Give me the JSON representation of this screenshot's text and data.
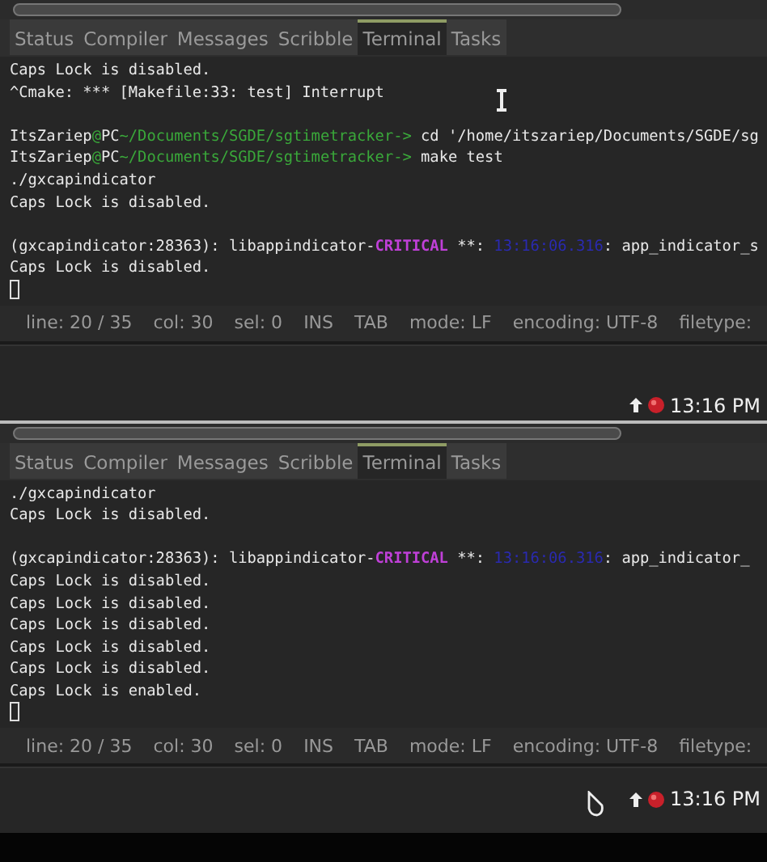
{
  "panels": [
    {
      "tabs": [
        {
          "label": "Status",
          "selected": false
        },
        {
          "label": "Compiler",
          "selected": false
        },
        {
          "label": "Messages",
          "selected": false
        },
        {
          "label": "Scribble",
          "selected": false
        },
        {
          "label": "Terminal",
          "selected": true
        },
        {
          "label": "Tasks",
          "selected": false
        }
      ],
      "lines": [
        {
          "kind": "text",
          "segments": [
            {
              "text": "Caps Lock is disabled.",
              "kind": "plain"
            }
          ]
        },
        {
          "kind": "text",
          "segments": [
            {
              "text": "^Cmake: *** [Makefile:33: test] Interrupt",
              "kind": "plain"
            }
          ]
        },
        {
          "kind": "blank"
        },
        {
          "kind": "text",
          "segments": [
            {
              "text": "ItsZariep",
              "kind": "plain"
            },
            {
              "text": "@",
              "kind": "accent"
            },
            {
              "text": "PC",
              "kind": "plain"
            },
            {
              "text": "~/Documents/SGDE/sgtimetracker->",
              "kind": "accent"
            },
            {
              "text": " cd '/home/itszariep/Documents/SGDE/sg",
              "kind": "plain"
            }
          ]
        },
        {
          "kind": "text",
          "segments": [
            {
              "text": "ItsZariep",
              "kind": "plain"
            },
            {
              "text": "@",
              "kind": "accent"
            },
            {
              "text": "PC",
              "kind": "plain"
            },
            {
              "text": "~/Documents/SGDE/sgtimetracker->",
              "kind": "accent"
            },
            {
              "text": " make test",
              "kind": "plain"
            }
          ]
        },
        {
          "kind": "text",
          "segments": [
            {
              "text": "./gxcapindicator",
              "kind": "plain"
            }
          ]
        },
        {
          "kind": "text",
          "segments": [
            {
              "text": "Caps Lock is disabled.",
              "kind": "plain"
            }
          ]
        },
        {
          "kind": "blank"
        },
        {
          "kind": "text",
          "segments": [
            {
              "text": "(gxcapindicator:28363): libappindicator-",
              "kind": "plain"
            },
            {
              "text": "CRITICAL",
              "kind": "critical"
            },
            {
              "text": " **: ",
              "kind": "plain"
            },
            {
              "text": "13:16:06.316",
              "kind": "timestamp"
            },
            {
              "text": ": app_indicator_s",
              "kind": "plain"
            }
          ]
        },
        {
          "kind": "text",
          "segments": [
            {
              "text": "Caps Lock is disabled.",
              "kind": "plain"
            }
          ]
        }
      ],
      "status_bar": [
        "line: 20 / 35",
        "col: 30",
        "sel: 0",
        "INS",
        "TAB",
        "mode: LF",
        "encoding: UTF-8",
        "filetype:"
      ],
      "pointer": {
        "kind": "ibeam"
      },
      "clock": "13:16 PM"
    },
    {
      "tabs": [
        {
          "label": "Status",
          "selected": false
        },
        {
          "label": "Compiler",
          "selected": false
        },
        {
          "label": "Messages",
          "selected": false
        },
        {
          "label": "Scribble",
          "selected": false
        },
        {
          "label": "Terminal",
          "selected": true
        },
        {
          "label": "Tasks",
          "selected": false
        }
      ],
      "lines": [
        {
          "kind": "text",
          "segments": [
            {
              "text": "./gxcapindicator",
              "kind": "plain"
            }
          ]
        },
        {
          "kind": "text",
          "segments": [
            {
              "text": "Caps Lock is disabled.",
              "kind": "plain"
            }
          ]
        },
        {
          "kind": "blank"
        },
        {
          "kind": "text",
          "segments": [
            {
              "text": "(gxcapindicator:28363): libappindicator-",
              "kind": "plain"
            },
            {
              "text": "CRITICAL",
              "kind": "critical"
            },
            {
              "text": " **: ",
              "kind": "plain"
            },
            {
              "text": "13:16:06.316",
              "kind": "timestamp"
            },
            {
              "text": ": app_indicator_",
              "kind": "plain"
            }
          ]
        },
        {
          "kind": "text",
          "segments": [
            {
              "text": "Caps Lock is disabled.",
              "kind": "plain"
            }
          ]
        },
        {
          "kind": "text",
          "segments": [
            {
              "text": "Caps Lock is disabled.",
              "kind": "plain"
            }
          ]
        },
        {
          "kind": "text",
          "segments": [
            {
              "text": "Caps Lock is disabled.",
              "kind": "plain"
            }
          ]
        },
        {
          "kind": "text",
          "segments": [
            {
              "text": "Caps Lock is disabled.",
              "kind": "plain"
            }
          ]
        },
        {
          "kind": "text",
          "segments": [
            {
              "text": "Caps Lock is disabled.",
              "kind": "plain"
            }
          ]
        },
        {
          "kind": "text",
          "segments": [
            {
              "text": "Caps Lock is enabled.",
              "kind": "plain"
            }
          ]
        }
      ],
      "status_bar": [
        "line: 20 / 35",
        "col: 30",
        "sel: 0",
        "INS",
        "TAB",
        "mode: LF",
        "encoding: UTF-8",
        "filetype:"
      ],
      "pointer": {
        "kind": "hand"
      },
      "clock": "13:16 PM"
    }
  ]
}
